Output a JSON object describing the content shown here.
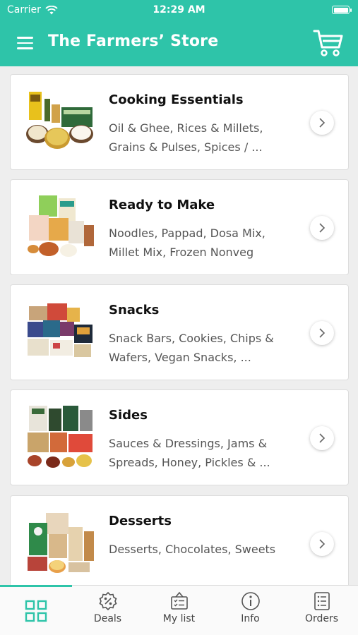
{
  "status_bar": {
    "carrier": "Carrier",
    "time": "12:29 AM"
  },
  "header": {
    "title": "The Farmers’ Store"
  },
  "categories": [
    {
      "title": "Cooking Essentials",
      "subtitle": "Oil & Ghee, Rices & Millets, Grains & Pulses, Spices / ..."
    },
    {
      "title": "Ready to Make",
      "subtitle": "Noodles, Pappad, Dosa Mix, Millet Mix, Frozen Nonveg"
    },
    {
      "title": "Snacks",
      "subtitle": "Snack Bars, Cookies, Chips & Wafers, Vegan Snacks, ..."
    },
    {
      "title": "Sides",
      "subtitle": "Sauces & Dressings, Jams & Spreads, Honey, Pickles & ..."
    },
    {
      "title": "Desserts",
      "subtitle": "Desserts, Chocolates, Sweets"
    }
  ],
  "tabs": [
    {
      "label": "",
      "icon": "grid-icon",
      "active": true
    },
    {
      "label": "Deals",
      "icon": "deals-badge-icon"
    },
    {
      "label": "My list",
      "icon": "basket-list-icon"
    },
    {
      "label": "Info",
      "icon": "info-icon"
    },
    {
      "label": "Orders",
      "icon": "orders-list-icon"
    }
  ],
  "colors": {
    "accent": "#2ec4a9",
    "background": "#eeeeee",
    "card": "#ffffff"
  }
}
